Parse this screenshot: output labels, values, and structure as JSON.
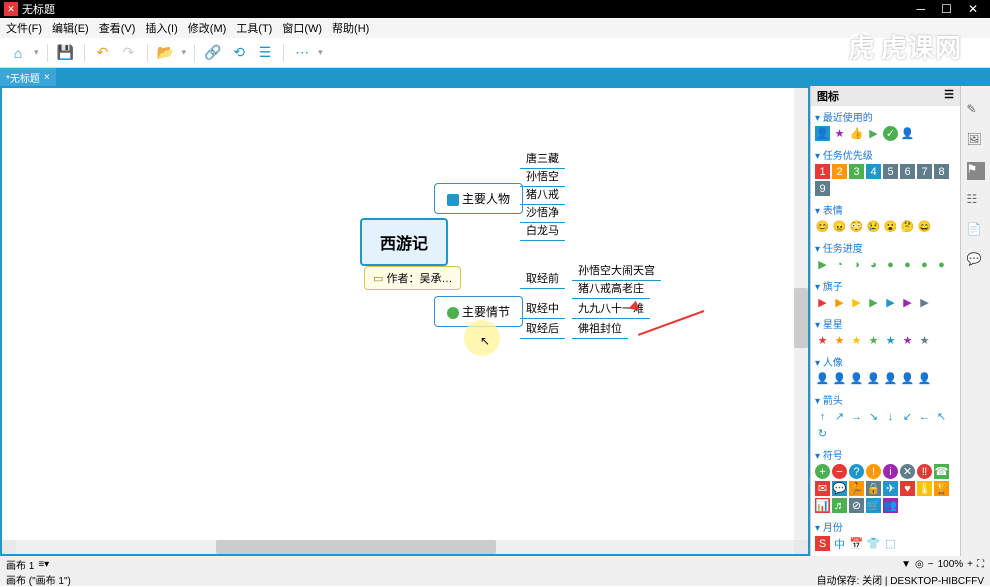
{
  "titlebar": {
    "title": "无标题"
  },
  "menu": {
    "file": "文件(F)",
    "edit": "编辑(E)",
    "view": "查看(V)",
    "insert": "插入(I)",
    "modify": "修改(M)",
    "tools": "工具(T)",
    "window": "窗口(W)",
    "help": "帮助(H)"
  },
  "tab": {
    "name": "*无标题",
    "close": "×"
  },
  "mindmap": {
    "center": "西游记",
    "author": "作者：吴承…",
    "branch1": {
      "title": "主要人物",
      "leaves": [
        "唐三藏",
        "孙悟空",
        "猪八戒",
        "沙悟净",
        "白龙马"
      ]
    },
    "branch2": {
      "title": "主要情节",
      "sub1": {
        "title": "取经前",
        "leaves": [
          "孙悟空大闹天宫",
          "猪八戒高老庄"
        ]
      },
      "sub2": {
        "title": "取经中",
        "leaf": "九九八十一难"
      },
      "sub3": {
        "title": "取经后",
        "leaf": "佛祖封位"
      }
    }
  },
  "status": {
    "canvas": "画布 1",
    "zoom": "100%"
  },
  "footer": {
    "left": "画布 (\"画布 1\")",
    "right": "自动保存: 关闭 | DESKTOP-HIBCFFV"
  },
  "sidepanel": {
    "title": "图标",
    "groups": {
      "recent": "最近使用的",
      "priority": "任务优先级",
      "emoji": "表情",
      "progress": "任务进度",
      "flags": "旗子",
      "stars": "星星",
      "people": "人像",
      "arrows": "箭头",
      "symbols": "符号",
      "months": "月份"
    }
  },
  "watermark": "虎课网"
}
